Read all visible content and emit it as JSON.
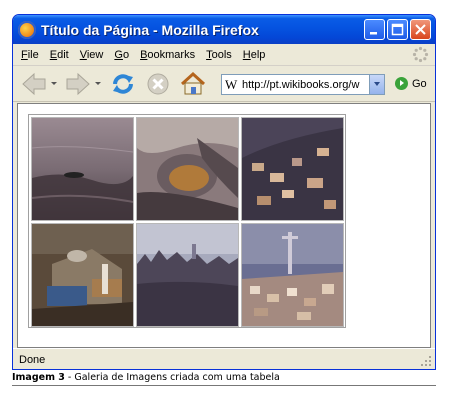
{
  "window": {
    "title": "Título da Página - Mozilla Firefox"
  },
  "menu": [
    {
      "key": "F",
      "rest": "ile"
    },
    {
      "key": "E",
      "rest": "dit"
    },
    {
      "key": "V",
      "rest": "iew"
    },
    {
      "key": "G",
      "rest": "o"
    },
    {
      "key": "B",
      "rest": "ookmarks"
    },
    {
      "key": "T",
      "rest": "ools"
    },
    {
      "key": "H",
      "rest": "elp"
    }
  ],
  "toolbar": {
    "url": "http://pt.wikibooks.org/w",
    "favicon_letter": "W",
    "go_label": "Go"
  },
  "gallery": {
    "photos": [
      {
        "subject": "dark water with small boat"
      },
      {
        "subject": "aerial bay and rocky shore"
      },
      {
        "subject": "aerial town on hillside"
      },
      {
        "subject": "observatory domes and buildings"
      },
      {
        "subject": "skyline over dark forest"
      },
      {
        "subject": "city with tall monument"
      }
    ]
  },
  "status": {
    "text": "Done"
  },
  "caption": {
    "label": "Imagem 3",
    "text": " - Galeria de Imagens criada com uma tabela"
  }
}
